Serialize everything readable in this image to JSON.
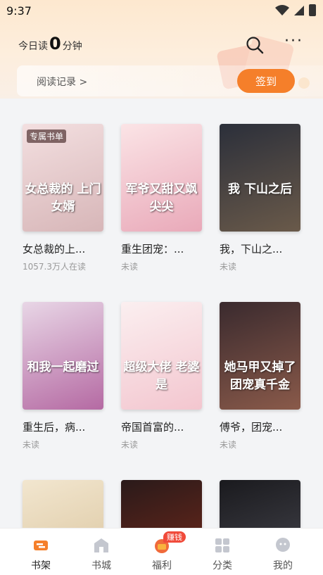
{
  "status": {
    "time": "9:37"
  },
  "header": {
    "reading_prefix": "今日读",
    "reading_minutes": "0",
    "reading_suffix": "分钟",
    "history_link": "阅读记录 >",
    "checkin_label": "签到"
  },
  "books": [
    {
      "title": "女总裁的上...",
      "sub": "1057.3万人在读",
      "badge": "专属书单",
      "cover_text": "女总裁的 上门女婿",
      "cover_colors": [
        "#f3dfe0",
        "#d7b6b8"
      ]
    },
    {
      "title": "重生团宠：...",
      "sub": "未读",
      "badge": "",
      "cover_text": "军爷又甜又飒 尖尖",
      "cover_colors": [
        "#fbe4e6",
        "#e9a9b9"
      ]
    },
    {
      "title": "我，下山之...",
      "sub": "未读",
      "badge": "",
      "cover_text": "我 下山之后",
      "cover_colors": [
        "#2b2f3a",
        "#6a5a4a"
      ]
    },
    {
      "title": "重生后，病...",
      "sub": "未读",
      "badge": "",
      "cover_text": "和我一起磨过",
      "cover_colors": [
        "#e8d6e6",
        "#b56aa3"
      ]
    },
    {
      "title": "帝国首富的...",
      "sub": "未读",
      "badge": "",
      "cover_text": "超级大佬 老婆是",
      "cover_colors": [
        "#fbeff0",
        "#f3c6cf"
      ]
    },
    {
      "title": "傅爷，团宠...",
      "sub": "未读",
      "badge": "",
      "cover_text": "她马甲又掉了 团宠真千金",
      "cover_colors": [
        "#3a2a2e",
        "#8a5a4a"
      ]
    },
    {
      "title": "",
      "sub": "",
      "badge": "",
      "cover_text": "",
      "cover_colors": [
        "#f2e6cf",
        "#d8c29a"
      ]
    },
    {
      "title": "",
      "sub": "",
      "badge": "",
      "cover_text": "",
      "cover_colors": [
        "#2a1a1a",
        "#7a2a1a"
      ]
    },
    {
      "title": "",
      "sub": "",
      "badge": "",
      "cover_text": "",
      "cover_colors": [
        "#1a1a1e",
        "#4a4a52"
      ]
    }
  ],
  "tabs": [
    {
      "label": "书架",
      "icon": "bookshelf-icon",
      "active": true
    },
    {
      "label": "书城",
      "icon": "bookstore-icon",
      "active": false
    },
    {
      "label": "福利",
      "icon": "welfare-icon",
      "active": false,
      "badge": "赚钱"
    },
    {
      "label": "分类",
      "icon": "category-icon",
      "active": false
    },
    {
      "label": "我的",
      "icon": "profile-icon",
      "active": false
    }
  ],
  "colors": {
    "accent": "#f57f2a",
    "badge_red": "#f04a3a"
  }
}
